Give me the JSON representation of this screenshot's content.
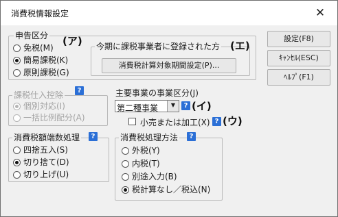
{
  "window": {
    "title": "消費税情報設定"
  },
  "filing": {
    "legend": "申告区分",
    "marker_a": "(ア)",
    "options": [
      "免税(M)",
      "簡易課税(K)",
      "原則課税(G)"
    ],
    "selected_index": 1
  },
  "registration": {
    "label": "今期に課税事業者に登録された方",
    "marker_e": "(エ)",
    "button": "消費税計算対象期間設定(P)..."
  },
  "buttons": {
    "ok": "設定(F8)",
    "cancel": "ｷｬﾝｾﾙ(ESC)",
    "help": "ﾍﾙﾌﾟ(F1)"
  },
  "input_deduction": {
    "legend": "課税仕入控除",
    "options": [
      "個別対応(I)",
      "一括比例配分(A)"
    ],
    "selected_index": 0,
    "disabled": true
  },
  "main_business": {
    "label": "主要事業の事業区分(J)",
    "value": "第二種事業",
    "marker_i": "(イ)",
    "checkbox_label": "小売または加工(X)",
    "checked": false,
    "marker_u": "(ウ)"
  },
  "rounding": {
    "legend": "消費税額端数処理",
    "options": [
      "四捨五入(S)",
      "切り捨て(D)",
      "切り上げ(U)"
    ],
    "selected_index": 1
  },
  "tax_method": {
    "legend": "消費税処理方法",
    "options": [
      "外税(Y)",
      "内税(T)",
      "別途入力(B)",
      "税計算なし／税込(N)"
    ],
    "selected_index": 3
  },
  "icons": {
    "help": "?",
    "close": "✕",
    "dropdown": "▼"
  }
}
